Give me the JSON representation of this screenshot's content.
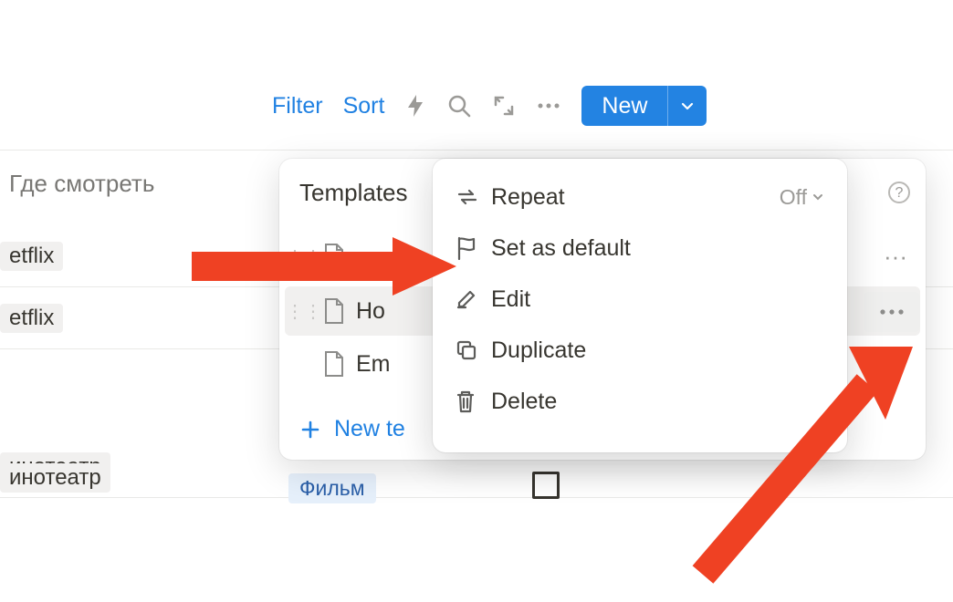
{
  "toolbar": {
    "filter": "Filter",
    "sort": "Sort",
    "new": "New"
  },
  "column_header": "Где смотреть",
  "rows": [
    {
      "tag": "etflix"
    },
    {
      "tag": "etflix"
    },
    {
      "tag": "инотеатр"
    },
    {
      "tag": "инотеатр"
    }
  ],
  "film_chip": "Фильм",
  "templates": {
    "title": "Templates",
    "items": [
      {
        "name": ""
      },
      {
        "name": "Ho"
      },
      {
        "name": "Em"
      }
    ],
    "new_label": "New te"
  },
  "ctx": {
    "repeat": "Repeat",
    "repeat_state": "Off",
    "set_default": "Set as default",
    "edit": "Edit",
    "duplicate": "Duplicate",
    "delete": "Delete"
  }
}
